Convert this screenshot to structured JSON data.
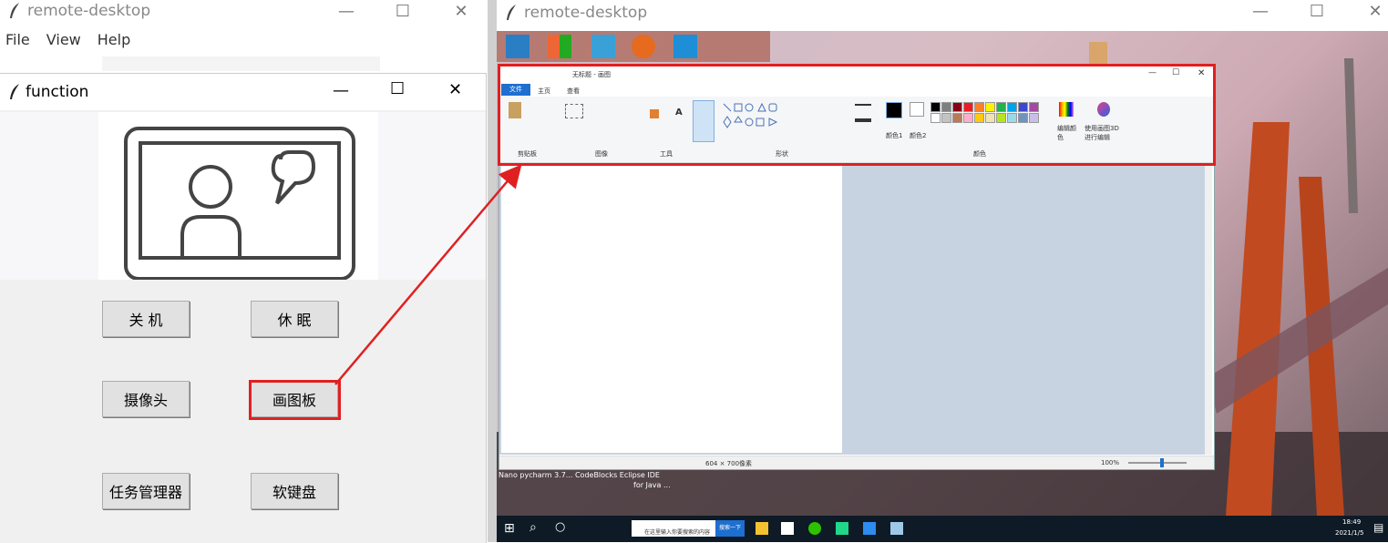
{
  "left_window": {
    "title": "remote-desktop",
    "menu": [
      "File",
      "View",
      "Help"
    ]
  },
  "function_window": {
    "title": "function",
    "buttons": {
      "shutdown": "关 机",
      "sleep": "休 眠",
      "camera": "摄像头",
      "paint": "画图板",
      "task_manager": "任务管理器",
      "soft_keyboard": "软键盘"
    }
  },
  "right_window": {
    "title": "remote-desktop"
  },
  "paint_app": {
    "title": "无标题 - 画图",
    "tabs": [
      "文件",
      "主页",
      "查看"
    ],
    "groups": [
      "剪贴板",
      "图像",
      "工具",
      "形状",
      "颜色"
    ],
    "status_size": "604 × 700像素",
    "zoom": "100%",
    "color1_label": "颜色1",
    "color2_label": "颜色2",
    "edit_colors": "编辑颜色",
    "paint3d": "使用画图3D进行编辑"
  },
  "desktop": {
    "info_text": "Nano pycharm 3.7... CodeBlocks Eclipse IDE",
    "info_text2": "for Java ...",
    "search_placeholder": "在这里输入你要搜索的内容",
    "search_button": "搜索一下",
    "clock_time": "18:49",
    "clock_date": "2021/1/5"
  },
  "colors": {
    "highlight": "#e02020",
    "paint_accent": "#1e6fcf"
  }
}
